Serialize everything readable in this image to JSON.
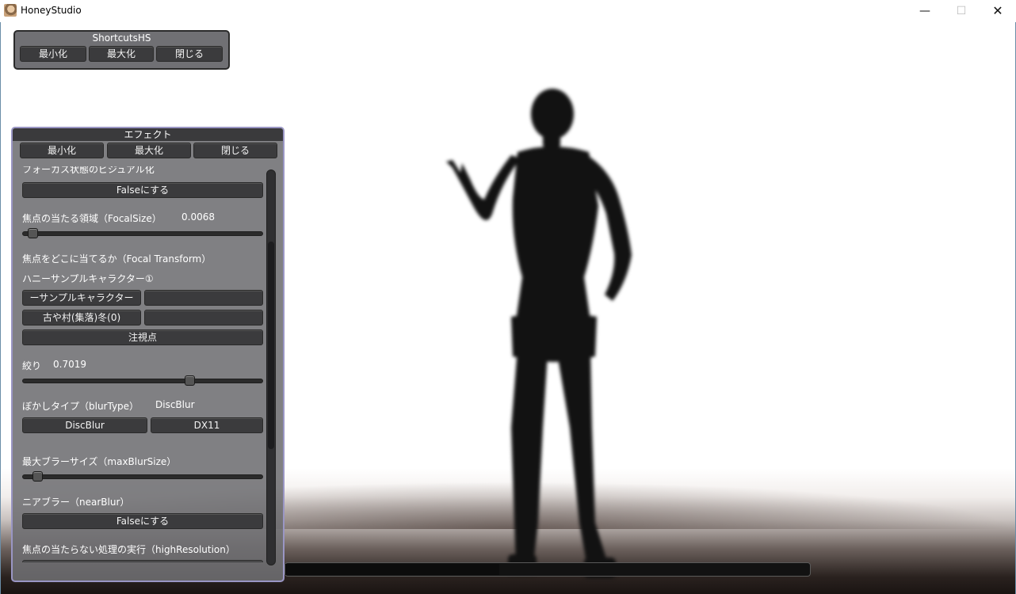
{
  "window": {
    "title": "HoneyStudio",
    "controls": {
      "minimize": "—",
      "maximize": "☐",
      "close": "✕"
    }
  },
  "shortcuts_panel": {
    "title": "ShortcutsHS",
    "buttons": [
      "最小化",
      "最大化",
      "閉じる"
    ]
  },
  "effect_panel": {
    "title": "エフェクト",
    "buttons": [
      "最小化",
      "最大化",
      "閉じる"
    ],
    "cut_label": "フォーカス状態のビジュアル化",
    "visualize_button": "Falseにする",
    "focal_size": {
      "label": "焦点の当たる領域（FocalSize）",
      "value": "0.0068",
      "slider": 0.02
    },
    "focal_transform": {
      "label": "焦点をどこに当てるか（Focal Transform）",
      "target_name": "ハニーサンプルキャラクター①",
      "row1": [
        "ーサンプルキャラクター",
        ""
      ],
      "row2": [
        "古や村(集落)冬(0)",
        ""
      ],
      "gaze_button": "注視点"
    },
    "aperture": {
      "label": "絞り",
      "value": "0.7019",
      "slider": 0.7019
    },
    "blur_type": {
      "label": "ぼかしタイプ（blurType）",
      "value": "DiscBlur",
      "buttons": [
        "DiscBlur",
        "DX11"
      ]
    },
    "max_blur_size": {
      "label": "最大ブラーサイズ（maxBlurSize）",
      "slider": 0.04
    },
    "near_blur": {
      "label": "ニアブラー（nearBlur）",
      "button": "Falseにする"
    },
    "high_resolution": {
      "label": "焦点の当たらない処理の実行（highResolution）"
    }
  },
  "colors": {
    "panel_border_effect": "#9a96c4",
    "button_bg": "#3b3b3d"
  }
}
